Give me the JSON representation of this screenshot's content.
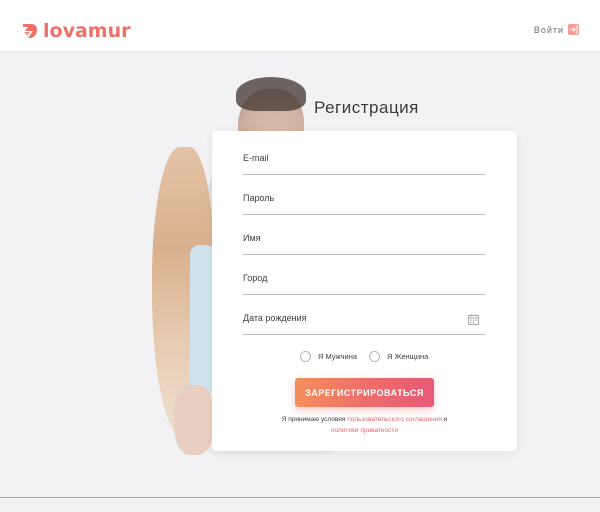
{
  "brand": {
    "name": "lovamur",
    "color": "#ef6f6a",
    "icon": "lovamur-logo-mark"
  },
  "header": {
    "login_label": "Войти",
    "login_icon": "login-arrow-icon"
  },
  "page": {
    "title": "Регистрация"
  },
  "form": {
    "fields": [
      {
        "id": "email",
        "label": "E-mail",
        "value": ""
      },
      {
        "id": "password",
        "label": "Пароль",
        "value": ""
      },
      {
        "id": "name",
        "label": "Имя",
        "value": ""
      },
      {
        "id": "city",
        "label": "Город",
        "value": ""
      },
      {
        "id": "birthdate",
        "label": "Дата рождения",
        "value": "",
        "icon": "calendar-icon"
      }
    ],
    "gender": [
      {
        "label": "Я Мужчина",
        "checked": false
      },
      {
        "label": "Я Женщина",
        "checked": false
      }
    ],
    "submit_label": "ЗАРЕГИСТРИРОВАТЬСЯ",
    "agreement": {
      "prefix": "Я принимаю условия ",
      "terms_link": "пользовательского соглашения",
      "conjunction": " и",
      "privacy_link": "политики приватности"
    }
  },
  "colors": {
    "accent": "#ef6f6a",
    "button_gradient_start": "#f4905c",
    "button_gradient_end": "#e65a76",
    "link": "#e8646d",
    "background": "#f2f1f3"
  }
}
